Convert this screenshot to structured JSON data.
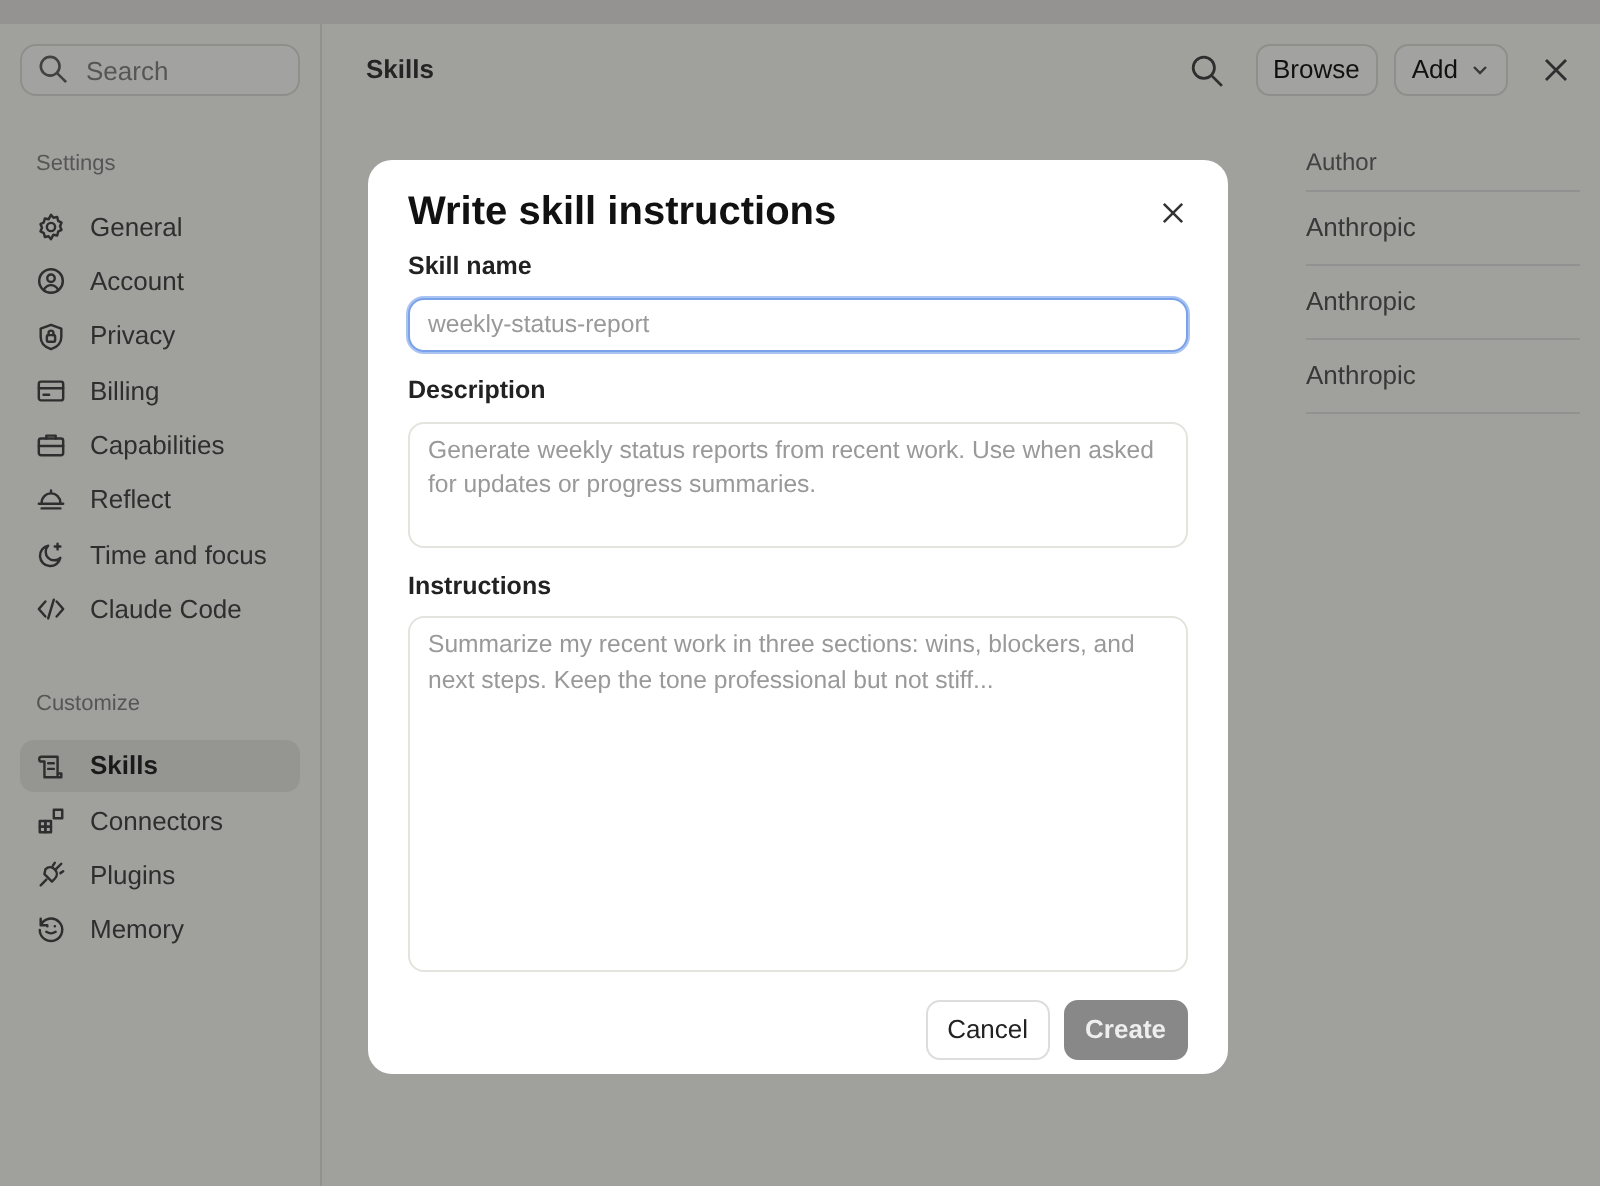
{
  "sidebar": {
    "search": {
      "placeholder": "Search"
    },
    "sections": [
      {
        "title": "Settings",
        "items": [
          {
            "label": "General",
            "selected": false
          },
          {
            "label": "Account",
            "selected": false
          },
          {
            "label": "Privacy",
            "selected": false
          },
          {
            "label": "Billing",
            "selected": false
          },
          {
            "label": "Capabilities",
            "selected": false
          },
          {
            "label": "Reflect",
            "selected": false
          },
          {
            "label": "Time and focus",
            "selected": false
          },
          {
            "label": "Claude Code",
            "selected": false
          }
        ]
      },
      {
        "title": "Customize",
        "items": [
          {
            "label": "Skills",
            "selected": true
          },
          {
            "label": "Connectors",
            "selected": false
          },
          {
            "label": "Plugins",
            "selected": false
          },
          {
            "label": "Memory",
            "selected": false
          }
        ]
      }
    ]
  },
  "header": {
    "title": "Skills",
    "buttons": [
      "Browse",
      "Add"
    ]
  },
  "table": {
    "columns": [
      "Author"
    ],
    "rows": [
      [
        "Anthropic"
      ],
      [
        "Anthropic"
      ],
      [
        "Anthropic"
      ]
    ]
  },
  "dialog": {
    "title": "Write skill instructions",
    "fields": [
      {
        "label": "Skill name",
        "kind": "input",
        "placeholder": "weekly-status-report",
        "focused": true
      },
      {
        "label": "Description",
        "kind": "textarea",
        "placeholder": "Generate weekly status reports from recent work. Use when asked for updates or progress summaries.",
        "focused": false
      },
      {
        "label": "Instructions",
        "kind": "textarea-large",
        "placeholder": "Summarize my recent work in three sections: wins, blockers, and next steps. Keep the tone professional but not stiff...",
        "focused": false
      }
    ],
    "buttons": [
      {
        "label": "Cancel",
        "kind": "secondary"
      },
      {
        "label": "Create",
        "kind": "primary",
        "disabled": true
      }
    ]
  }
}
